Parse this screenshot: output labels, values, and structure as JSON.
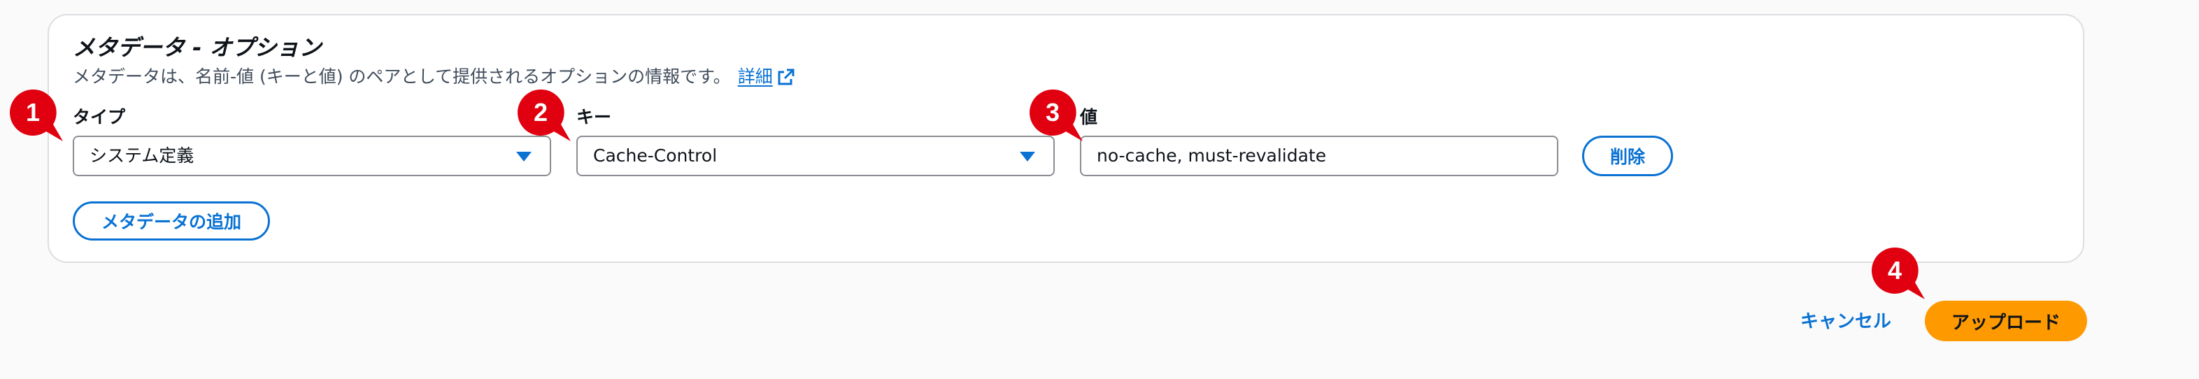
{
  "section": {
    "title": "メタデータ - オプション",
    "description": "メタデータは、名前-値 (キーと値) のペアとして提供されるオプションの情報です。",
    "details_link": "詳細"
  },
  "fields": {
    "type": {
      "label": "タイプ",
      "value": "システム定義"
    },
    "key": {
      "label": "キー",
      "value": "Cache-Control"
    },
    "value": {
      "label": "値",
      "value": "no-cache, must-revalidate"
    }
  },
  "buttons": {
    "delete": "削除",
    "add_metadata": "メタデータの追加",
    "cancel": "キャンセル",
    "upload": "アップロード"
  },
  "markers": [
    "1",
    "2",
    "3",
    "4"
  ],
  "colors": {
    "link": "#0972d3",
    "primary_button": "#ff9900",
    "marker": "#e0000f"
  }
}
